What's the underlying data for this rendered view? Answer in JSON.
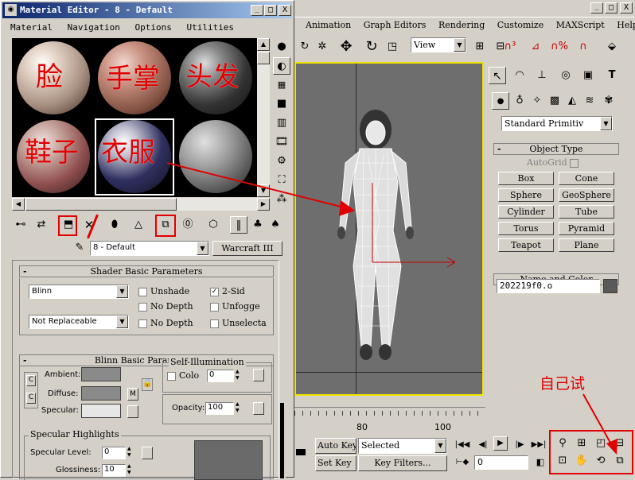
{
  "main_menu": [
    "Animation",
    "Graph Editors",
    "Rendering",
    "Customize",
    "MAXScript",
    "Help"
  ],
  "main_toolbar": {
    "view_dropdown": "View"
  },
  "window_buttons": {
    "minimize": "_",
    "maximize": "□",
    "close": "X"
  },
  "mat_editor": {
    "title": "Material Editor - 8 - Default",
    "menu": [
      "Material",
      "Navigation",
      "Options",
      "Utilities"
    ],
    "slots": [
      {
        "label": "脸"
      },
      {
        "label": "手掌"
      },
      {
        "label": "头发"
      },
      {
        "label": "鞋子"
      },
      {
        "label": "衣服"
      },
      {
        "label": ""
      }
    ],
    "material_name": "8 - Default",
    "material_type": "Warcraft III",
    "shader": {
      "header": "Shader Basic Parameters",
      "shader_type": "Blinn",
      "map_mode": "Not Replaceable",
      "checks": [
        {
          "label": "Unshade",
          "checked": false
        },
        {
          "label": "2-Sid",
          "checked": true
        },
        {
          "label": "No Depth",
          "checked": false
        },
        {
          "label": "Unfogge",
          "checked": false
        },
        {
          "label": "No Depth",
          "checked": false
        },
        {
          "label": "Unselecta",
          "checked": false
        }
      ]
    },
    "blinn": {
      "header": "Blinn Basic Parameters",
      "self_illum_title": "Self-Illumination",
      "color_label": "Colo",
      "color_value": "0",
      "ambient_label": "Ambient:",
      "diffuse_label": "Diffuse:",
      "specular_label": "Specular:",
      "m_button": "M",
      "opacity_label": "Opacity:",
      "opacity_value": "100"
    },
    "highlights": {
      "title": "Specular Highlights",
      "level_label": "Specular Level:",
      "level_value": "0",
      "gloss_label": "Glossiness:",
      "gloss_value": "10"
    }
  },
  "cmd_panel": {
    "dropdown": "Standard Primitiv",
    "object_type_header": "Object Type",
    "autogrid": "AutoGrid",
    "buttons": [
      "Box",
      "Cone",
      "Sphere",
      "GeoSphere",
      "Cylinder",
      "Tube",
      "Torus",
      "Pyramid",
      "Teapot",
      "Plane"
    ],
    "name_color_header": "Name and Color",
    "object_name": "202219f0.o"
  },
  "timeline": {
    "tick_80": "80",
    "tick_100": "100"
  },
  "anim_controls": {
    "auto_key": "Auto Key",
    "set_key": "Set Key",
    "selected": "Selected",
    "key_filters": "Key Filters...",
    "frame": "0"
  },
  "annotation": {
    "text": "自己试"
  },
  "colors": {
    "viewport_bg": "#6e6e6e",
    "annotation_red": "#e00000",
    "active_border": "#f2e200"
  }
}
